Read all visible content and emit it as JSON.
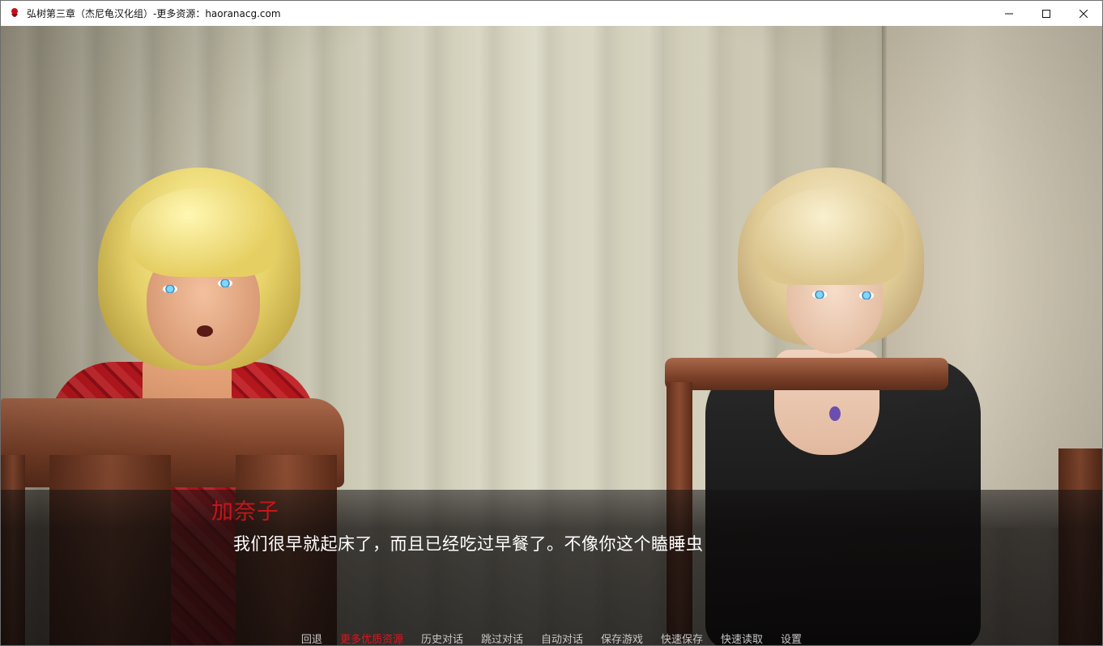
{
  "window": {
    "title": "弘树第三章（杰尼龟汉化组）-更多资源：haoranacg.com",
    "controls": [
      "minimize-icon",
      "maximize-icon",
      "close-icon"
    ]
  },
  "dialogue": {
    "speaker": "加奈子",
    "text": "我们很早就起床了，而且已经吃过早餐了。不像你这个瞌睡虫",
    "speaker_color": "#c4161c"
  },
  "quick_menu": {
    "items": [
      {
        "label": "回退",
        "accent": false
      },
      {
        "label": "更多优质资源",
        "accent": true
      },
      {
        "label": "历史对话",
        "accent": false
      },
      {
        "label": "跳过对话",
        "accent": false
      },
      {
        "label": "自动对话",
        "accent": false
      },
      {
        "label": "保存游戏",
        "accent": false
      },
      {
        "label": "快速保存",
        "accent": false
      },
      {
        "label": "快速读取",
        "accent": false
      },
      {
        "label": "设置",
        "accent": false
      }
    ],
    "accent_color": "#e0141e"
  }
}
